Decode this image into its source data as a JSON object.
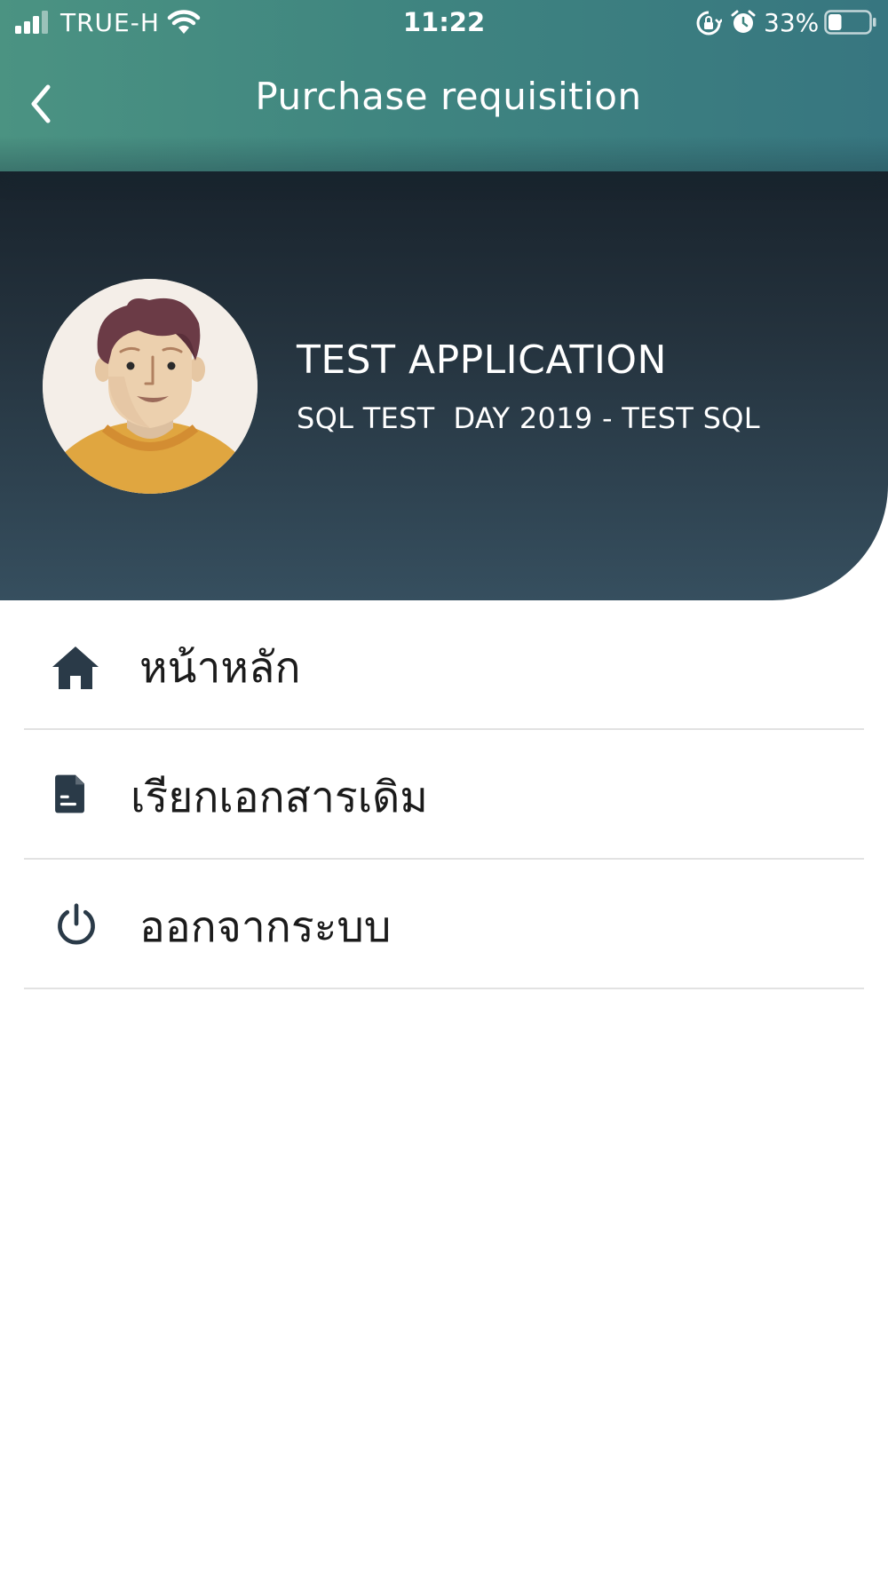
{
  "status_bar": {
    "carrier": "TRUE-H",
    "time": "11:22",
    "battery_percent": "33%",
    "battery_level": 0.33,
    "icons": [
      "signal-icon",
      "wifi-icon",
      "rotation-lock-icon",
      "alarm-icon",
      "battery-icon"
    ]
  },
  "nav": {
    "title": "Purchase requisition",
    "back_icon": "chevron-left-icon"
  },
  "profile": {
    "name": "TEST APPLICATION",
    "subtitle": "SQL TEST  DAY 2019 - TEST SQL",
    "avatar_icon": "user-avatar-illustration"
  },
  "menu": {
    "items": [
      {
        "label": "หน้าหลัก",
        "icon": "home-icon"
      },
      {
        "label": "เรียกเอกสารเดิม",
        "icon": "document-icon"
      },
      {
        "label": "ออกจากระบบ",
        "icon": "power-icon"
      }
    ]
  },
  "colors": {
    "header_gradient_start": "#4b9382",
    "header_gradient_end": "#377680",
    "panel_gradient_top": "#17212a",
    "panel_gradient_bottom": "#364f5f",
    "icon_color": "#2a3a48",
    "divider": "#e2e2e2"
  }
}
